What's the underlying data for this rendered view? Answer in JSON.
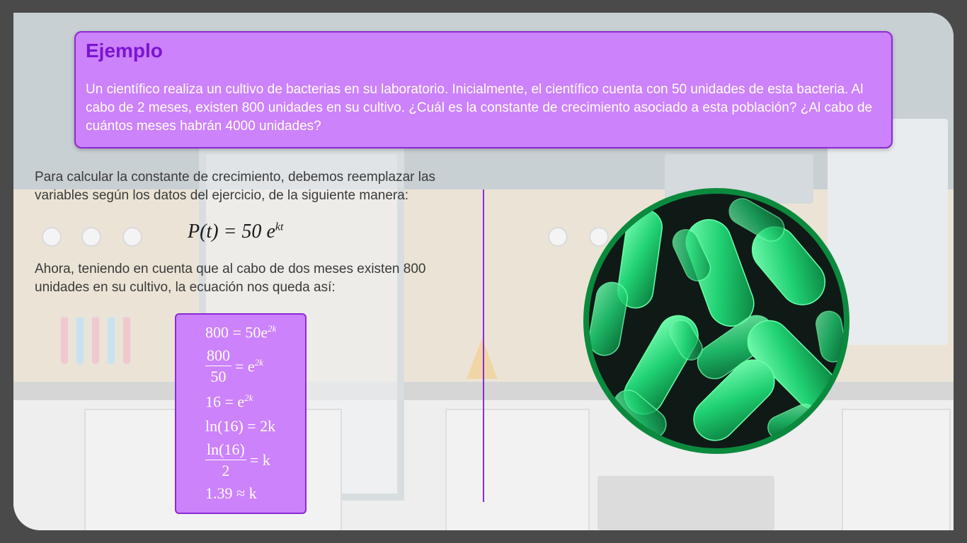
{
  "example": {
    "title": "Ejemplo",
    "body": "Un científico realiza un cultivo de bacterias en su laboratorio. Inicialmente, el científico cuenta con 50 unidades de esta bacteria. Al cabo de 2 meses, existen 800 unidades en su cultivo. ¿Cuál es la constante de crecimiento asociado a esta población? ¿Al cabo de cuántos meses habrán 4000 unidades?"
  },
  "paragraph1": "Para calcular la constante de crecimiento, debemos reemplazar las variables según los datos del ejercicio, de la siguiente manera:",
  "formula": {
    "lhs": "P(t) = 50 ",
    "base": "e",
    "exponent": "kt"
  },
  "paragraph2": "Ahora, teniendo en cuenta que al cabo de dos meses existen 800 unidades en su cultivo, la ecuación nos queda así:",
  "steps": {
    "s1": {
      "text": "800 = 50e",
      "exp": "2k"
    },
    "s2": {
      "num": "800",
      "den": "50",
      "rest": "= e",
      "exp": "2k"
    },
    "s3": {
      "text": "16 = e",
      "exp": "2k"
    },
    "s4": {
      "text": "ln(16) = 2k"
    },
    "s5": {
      "num": "ln(16)",
      "den": "2",
      "rest": "= k"
    },
    "s6": {
      "text": "1.39 ≈ k"
    }
  },
  "colors": {
    "card": "#cc82fa",
    "card_border": "#8b2ad6",
    "title": "#7a14d2",
    "bacteria_ring": "#0b8a3e",
    "bacteria_fill": "#0f1a17"
  },
  "image": {
    "icon": "bacteria-illustration"
  }
}
